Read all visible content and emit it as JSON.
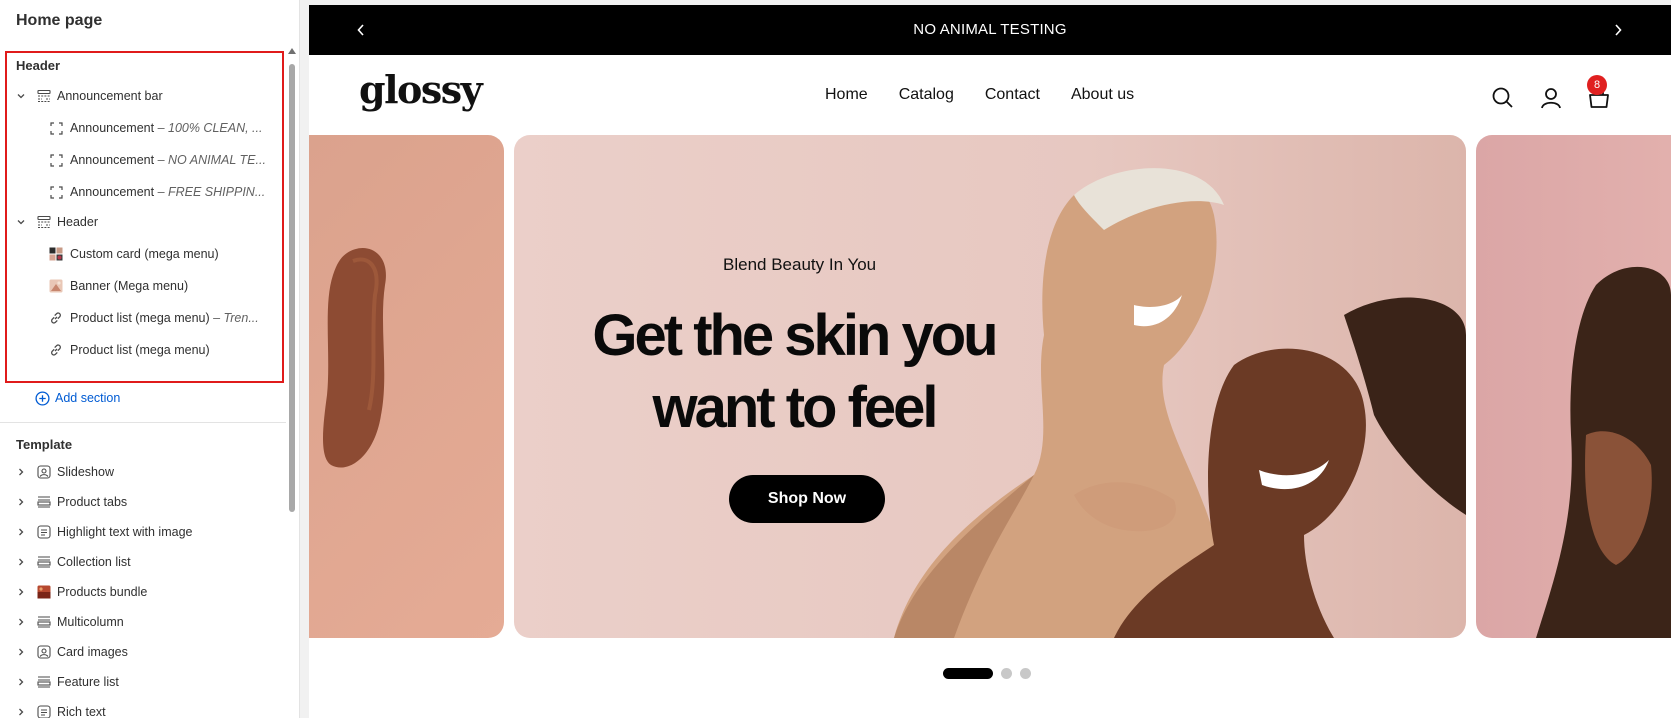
{
  "sidebar": {
    "title": "Home page",
    "header_group": {
      "label": "Header",
      "items": [
        {
          "label": "Announcement bar",
          "sub": ""
        },
        {
          "label": "Announcement",
          "sub": " – 100% CLEAN, ..."
        },
        {
          "label": "Announcement",
          "sub": " – NO ANIMAL TE..."
        },
        {
          "label": "Announcement",
          "sub": " – FREE SHIPPIN..."
        },
        {
          "label": "Header",
          "sub": ""
        },
        {
          "label": "Custom card (mega menu)",
          "sub": ""
        },
        {
          "label": "Banner (Mega menu)",
          "sub": ""
        },
        {
          "label": "Product list (mega menu)",
          "sub": " – Tren..."
        },
        {
          "label": "Product list (mega menu)",
          "sub": ""
        }
      ],
      "add_section": "Add section"
    },
    "template_group": {
      "label": "Template",
      "items": [
        {
          "label": "Slideshow"
        },
        {
          "label": "Product tabs"
        },
        {
          "label": "Highlight text with image"
        },
        {
          "label": "Collection list"
        },
        {
          "label": "Products bundle"
        },
        {
          "label": "Multicolumn"
        },
        {
          "label": "Card images"
        },
        {
          "label": "Feature list"
        },
        {
          "label": "Rich text"
        }
      ]
    },
    "highlight_color": "#e01b1b"
  },
  "preview": {
    "announcement": {
      "text": "NO ANIMAL TESTING"
    },
    "header": {
      "logo": "glossy",
      "nav": [
        "Home",
        "Catalog",
        "Contact",
        "About us"
      ],
      "cart_count": "8"
    },
    "slide": {
      "kicker": "Blend Beauty In You",
      "headline": "Get the skin you want to feel",
      "button": "Shop Now"
    },
    "slide_count": 3,
    "active_slide": 1
  }
}
